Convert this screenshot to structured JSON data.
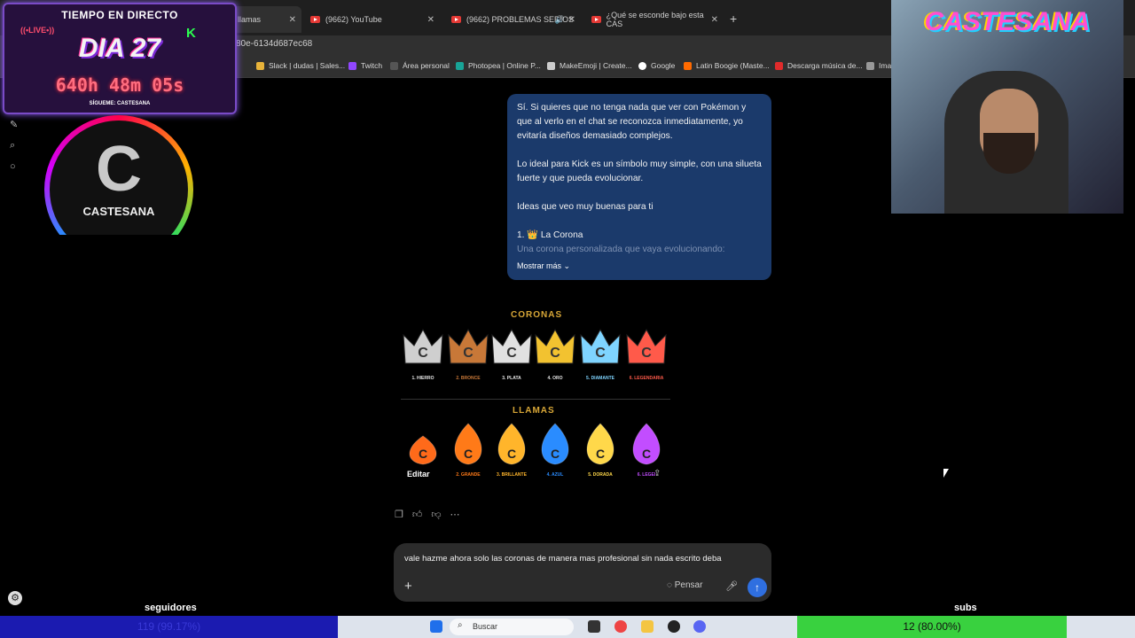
{
  "browser": {
    "tabs": [
      {
        "title": "llamas",
        "active": true
      },
      {
        "title": "(9662) YouTube"
      },
      {
        "title": "(9662) PROBLEMAS SERIOS"
      },
      {
        "title": "¿Qué se esconde bajo esta CAS"
      }
    ],
    "url": "80e-6134d687ec68",
    "bookmarks": [
      "Slack | dudas | Sales...",
      "Twitch",
      "Área personal",
      "Photopea | Online P...",
      "MakeEmoji | Create...",
      "Google",
      "Latin Boogie (Maste...",
      "Descarga música de...",
      "Imag"
    ]
  },
  "chat": {
    "message_paragraphs": [
      "Sí. Si quieres que no tenga nada que ver con Pokémon y que al verlo en el chat se reconozca inmediatamente, yo evitaría diseños demasiado complejos.",
      "Lo ideal para Kick es un símbolo muy simple, con una silueta fuerte y que pueda evolucionar.",
      "Ideas que veo muy buenas para ti",
      "1. 👑 La Corona"
    ],
    "message_fade": "Una corona personalizada que vaya evolucionando:",
    "show_more": "Mostrar más",
    "image": {
      "crowns_title": "CORONAS",
      "crowns": [
        {
          "label": "1. HIERRO",
          "color": "#cfcfcf"
        },
        {
          "label": "2. BRONCE",
          "color": "#c87838"
        },
        {
          "label": "3. PLATA",
          "color": "#e0e0e0"
        },
        {
          "label": "4. ORO",
          "color": "#f2c230"
        },
        {
          "label": "5. DIAMANTE",
          "color": "#7fd4ff"
        },
        {
          "label": "6. LEGENDARIA",
          "color": "#ff5a4a"
        }
      ],
      "flames_title": "LLAMAS",
      "flames": [
        {
          "label": "",
          "color": "#ff6a1a"
        },
        {
          "label": "2. GRANDE",
          "color": "#ff7a18"
        },
        {
          "label": "3. BRILLANTE",
          "color": "#ffb52b"
        },
        {
          "label": "4. AZUL",
          "color": "#2a8cff"
        },
        {
          "label": "5. DORADA",
          "color": "#ffd84a"
        },
        {
          "label": "6. LEGEI",
          "color": "#c24dff"
        }
      ],
      "edit_label": "Editar"
    },
    "input_text": "vale hazme ahora solo las coronas de manera mas profesional sin nada escrito deba",
    "think_label": "Pensar"
  },
  "taskbar": {
    "search_placeholder": "Buscar"
  },
  "overlay": {
    "live_title": "TIEMPO EN DIRECTO",
    "live_badge": "((•LIVE•))",
    "day": "DIA 27",
    "timer": "640h 48m 05s",
    "follow": "SÍGUEME: CASTESANA",
    "logo_name": "CASTESANA",
    "cam_title": "CASTESANA",
    "followers_label": "seguidores",
    "followers_value": "119 (99.17%)",
    "subs_label": "subs",
    "subs_value": "12 (80.00%)"
  }
}
